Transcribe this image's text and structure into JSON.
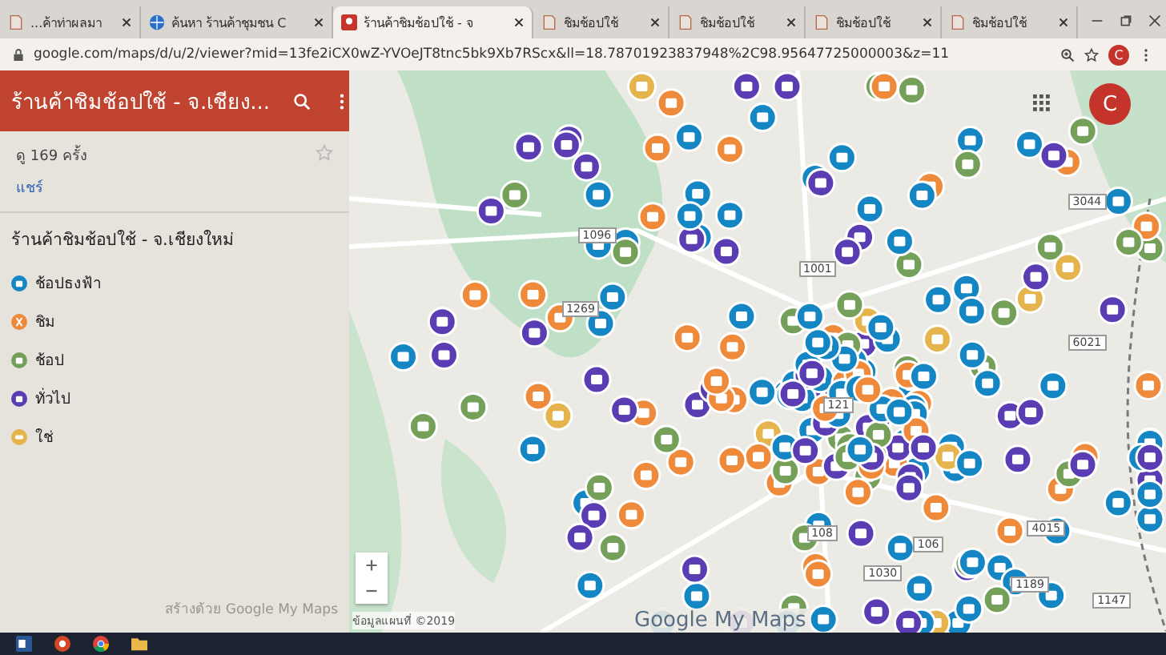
{
  "browser": {
    "tabs": [
      {
        "title": "...ค้าท่าผลมา",
        "selected": false,
        "kind": "doc"
      },
      {
        "title": "ค้นหา ร้านค้าชุมชน C",
        "selected": false,
        "kind": "globe"
      },
      {
        "title": "ร้านค้าชิมช้อปใช้ - จ",
        "selected": true,
        "kind": "pin"
      },
      {
        "title": "ชิมช้อปใช้",
        "selected": false,
        "kind": "doc"
      },
      {
        "title": "ชิมช้อปใช้",
        "selected": false,
        "kind": "doc"
      },
      {
        "title": "ชิมช้อปใช้",
        "selected": false,
        "kind": "doc"
      },
      {
        "title": "ชิมช้อปใช้",
        "selected": false,
        "kind": "doc"
      }
    ],
    "url": "google.com/maps/d/u/2/viewer?mid=13fe2iCX0wZ-YVOeJT8tnc5bk9Xb7RScx&ll=18.78701923837948%2C98.95647725000003&z=11",
    "profile_initial": "C"
  },
  "sidebar": {
    "title": "ร้านค้าชิมช้อปใช้ - จ.เชียง...",
    "views": "ดู 169 ครั้ง",
    "share": "แชร์",
    "layer_title": "ร้านค้าชิมช้อปใช้ - จ.เชียงใหม่",
    "legend": [
      {
        "label": "ช้อปธงฟ้า",
        "color": "#1586c4",
        "kind": "bag"
      },
      {
        "label": "ชิม",
        "color": "#ee8a3a",
        "kind": "fork"
      },
      {
        "label": "ช้อป",
        "color": "#74a05a",
        "kind": "bag"
      },
      {
        "label": "ทั่วไป",
        "color": "#5b3db3",
        "kind": "bag"
      },
      {
        "label": "ใช่",
        "color": "#e5b44c",
        "kind": "tag"
      }
    ],
    "credit": "สร้างด้วย Google My Maps"
  },
  "map": {
    "account_initial": "C",
    "routes": [
      "1096",
      "1269",
      "1001",
      "3044",
      "6021",
      "121",
      "108",
      "1030",
      "106",
      "1189",
      "1147",
      "4015"
    ],
    "attribution": "ข้อมูลแผนที่ ©2019",
    "brand": "Google My Maps"
  }
}
